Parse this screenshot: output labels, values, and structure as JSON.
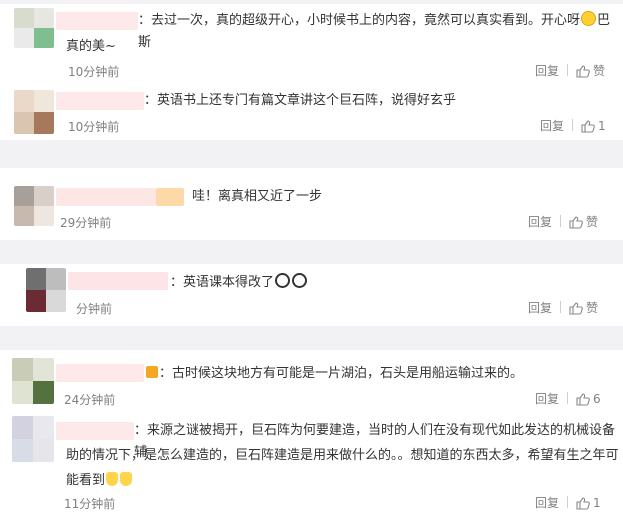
{
  "reply_label": "回复",
  "comments": [
    {
      "text_line1": "：去过一次，真的超级开心，小时候书上的内容，竟然可以真实看到。开心呀",
      "text_line1_after": "巴斯",
      "text_line2": "真的美~",
      "time": "10分钟前",
      "like_label": "赞",
      "emoji": "smile-emoji"
    },
    {
      "text": "：英语书上还专门有篇文章讲这个巨石阵，说得好玄乎",
      "time": "10分钟前",
      "like_label": "1"
    },
    {
      "text": "哇！离真相又近了一步",
      "time": "29分钟前",
      "like_label": "赞"
    },
    {
      "text": "：英语课本得改了",
      "time": "分钟前",
      "like_label": "赞",
      "emoji": "panda-emoji"
    },
    {
      "text": "古时候这块地方有可能是一片湖泊，石头是用船运输过来的。",
      "time": "24分钟前",
      "like_label": "6"
    },
    {
      "text_line1": "：来源之谜被揭开，巨石阵为何要建造，当时的人们在没有现代如此发达的机械设备辅",
      "text_line2": "助的情况下，是怎么建造的，巨石阵建造是用来做什么的。。想知道的东西太多，希望有生之年可",
      "text_line3": "能看到",
      "time": "11分钟前",
      "like_label": "1",
      "emoji": "cry-emoji"
    }
  ]
}
